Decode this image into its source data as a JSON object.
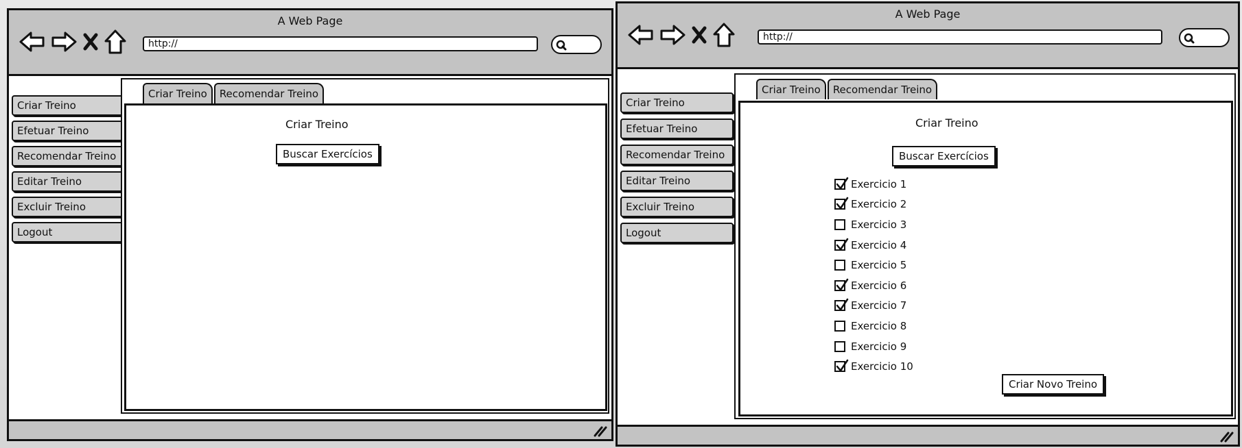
{
  "window_title": "A Web Page",
  "url_value": "http://",
  "sidebar": [
    "Criar Treino",
    "Efetuar Treino",
    "Recomendar Treino",
    "Editar Treino",
    "Excluir Treino",
    "Logout"
  ],
  "tabs": [
    "Criar Treino",
    "Recomendar Treino"
  ],
  "left_view": {
    "heading": "Criar Treino",
    "search_button": "Buscar Exercícios"
  },
  "right_view": {
    "heading": "Criar Treino",
    "search_button": "Buscar Exercícios",
    "exercises": [
      {
        "label": "Exercicio 1",
        "checked": true
      },
      {
        "label": "Exercicio 2",
        "checked": true
      },
      {
        "label": "Exercicio 3",
        "checked": false
      },
      {
        "label": "Exercicio 4",
        "checked": true
      },
      {
        "label": "Exercicio 5",
        "checked": false
      },
      {
        "label": "Exercicio 6",
        "checked": true
      },
      {
        "label": "Exercicio 7",
        "checked": true
      },
      {
        "label": "Exercicio 8",
        "checked": false
      },
      {
        "label": "Exercicio 9",
        "checked": false
      },
      {
        "label": "Exercicio 10",
        "checked": true
      }
    ],
    "create_button": "Criar Novo Treino"
  },
  "icons": {
    "back": "back-arrow-icon",
    "forward": "forward-arrow-icon",
    "stop": "close-icon",
    "home": "home-icon",
    "search": "search-icon",
    "resize": "resize-grip-icon",
    "check": "checkmark-icon"
  },
  "colors": {
    "chrome": "#c3c3c3",
    "button": "#d2d2d2",
    "ink": "#111111"
  }
}
